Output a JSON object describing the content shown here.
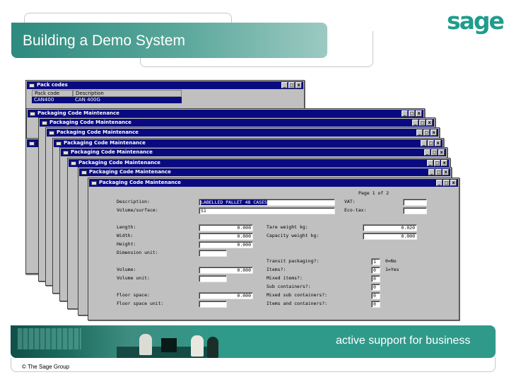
{
  "slide": {
    "title": "Building a Demo System",
    "logo": "sage",
    "tagline": "active support for business",
    "copyright": "© The Sage Group"
  },
  "pack_codes": {
    "title": "Pack codes",
    "col_pack_code": "Pack code",
    "col_description": "Description",
    "row_code": "CAN400",
    "row_description": "CAN 400G"
  },
  "stacked_window_title": "Packaging Code Maintenance",
  "window_buttons": {
    "minimize": "_",
    "maximize": "□",
    "close": "x"
  },
  "form": {
    "page": "Page 1 of 2",
    "description_label": "Description:",
    "description_value": "LABELLED  PALLET 48 CASES",
    "volume_surface_label": "Volume/surface:",
    "volume_surface_value": "S1",
    "vat_label": "VAT:",
    "vat_value": "",
    "eco_tax_label": "Eco-tax:",
    "eco_tax_value": "",
    "length_label": "Length:",
    "length_value": "0.000",
    "width_label": "Width:",
    "width_value": "0.000",
    "height_label": "Height:",
    "height_value": "0.000",
    "dimension_unit_label": "Dimension unit:",
    "dimension_unit_value": "",
    "tare_weight_label": "Tare weight kg:",
    "tare_weight_value": "0.020",
    "capacity_weight_label": "Capacity weight kg:",
    "capacity_weight_value": "0.000",
    "transit_packaging_label": "Transit packaging?:",
    "transit_packaging_value": "1",
    "legend_no": "0=No",
    "legend_yes": "1=Yes",
    "items_label": "Items?:",
    "items_value": "0",
    "mixed_items_label": "Mixed items?:",
    "mixed_items_value": "0",
    "sub_containers_label": "Sub containers?:",
    "sub_containers_value": "0",
    "mixed_sub_containers_label": "Mixed sub containers?:",
    "mixed_sub_containers_value": "0",
    "items_and_containers_label": "Items and containers?:",
    "items_and_containers_value": "0",
    "volume_label": "Volume:",
    "volume_value": "0.000",
    "volume_unit_label": "Volume unit:",
    "volume_unit_value": "",
    "floor_space_label": "Floor space:",
    "floor_space_value": "0.000",
    "floor_space_unit_label": "Floor space unit:",
    "floor_space_unit_value": ""
  }
}
